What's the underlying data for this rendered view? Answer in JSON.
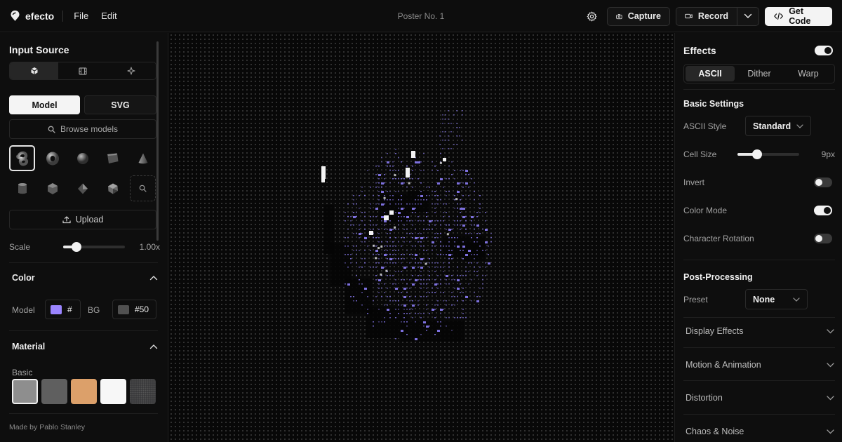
{
  "app": {
    "name": "efecto",
    "menu": [
      "File",
      "Edit"
    ],
    "document_title": "Poster No. 1"
  },
  "toolbar": {
    "capture_label": "Capture",
    "record_label": "Record",
    "get_code_label": "Get Code"
  },
  "input_source": {
    "title": "Input Source",
    "source_tabs": [
      "cube-icon",
      "film-icon",
      "sparkle-icon"
    ],
    "active_source_tab": 0,
    "type_tabs": [
      "Model",
      "SVG"
    ],
    "active_type": "Model",
    "browse_label": "Browse models",
    "model_shapes": [
      "knot",
      "torus",
      "sphere",
      "box",
      "cone",
      "cylinder",
      "dodecahedron",
      "octahedron",
      "icosahedron",
      "search"
    ],
    "selected_model": 0,
    "upload_label": "Upload",
    "scale": {
      "label": "Scale",
      "value": 1.0,
      "display": "1.00x"
    }
  },
  "color": {
    "title": "Color",
    "model_label": "Model",
    "model_value": "#",
    "model_color": "#9b85ff",
    "bg_label": "BG",
    "bg_value": "#50",
    "bg_color": "#505050"
  },
  "material": {
    "title": "Material",
    "group_label": "Basic",
    "swatches": [
      "#8e8e8e",
      "#5f5f5f",
      "#dca06a",
      "#f7f7f7",
      "#3a3a3c"
    ],
    "selected": 0
  },
  "footer": {
    "credit": "Made by Pablo Stanley"
  },
  "effects": {
    "title": "Effects",
    "enabled": true,
    "tabs": [
      "ASCII",
      "Dither",
      "Warp"
    ],
    "active_tab": "ASCII",
    "basic_settings_title": "Basic Settings",
    "ascii_style_label": "ASCII Style",
    "ascii_style_value": "Standard",
    "cell_size_label": "Cell Size",
    "cell_size_value": 9,
    "cell_size_display": "9px",
    "invert_label": "Invert",
    "invert": false,
    "color_mode_label": "Color Mode",
    "color_mode": true,
    "char_rotation_label": "Character Rotation",
    "char_rotation": false,
    "post_title": "Post-Processing",
    "preset_label": "Preset",
    "preset_value": "None",
    "sections": [
      "Display Effects",
      "Motion & Animation",
      "Distortion",
      "Chaos & Noise"
    ]
  },
  "canvas": {
    "accent_color": "#8b7cf6",
    "highlight_color": "#ffffff"
  }
}
